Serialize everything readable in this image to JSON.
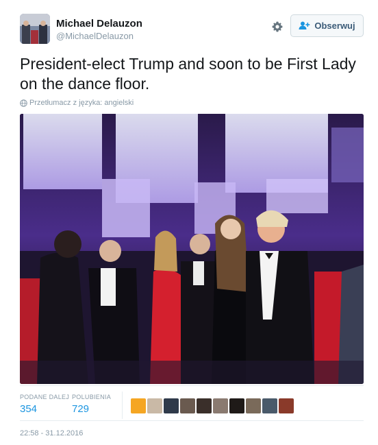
{
  "user": {
    "name": "Michael Delauzon",
    "handle": "@MichaelDelauzon"
  },
  "header": {
    "follow_label": "Obserwuj",
    "settings_icon": "gear-icon",
    "follow_icon": "add-person-icon"
  },
  "tweet": {
    "text": "President-elect Trump and soon to be First Lady on the dance floor.",
    "translate_label": "Przetłumacz z języka: angielski",
    "translate_icon": "globe-icon"
  },
  "stats": {
    "retweets_label": "PODANE DALEJ",
    "retweets_value": "354",
    "likes_label": "POLUBIENIA",
    "likes_value": "729"
  },
  "likers_colors": [
    "#f5a623",
    "#c9b9a6",
    "#2f3a4a",
    "#6a5a4f",
    "#3a2f2a",
    "#8a7a70",
    "#1f1a18",
    "#7a6a5a",
    "#4a5a6a",
    "#8a3a2a"
  ],
  "timestamp": "22:58 - 31.12.2016",
  "colors": {
    "link": "#1b95e0",
    "muted": "#8899a6"
  }
}
